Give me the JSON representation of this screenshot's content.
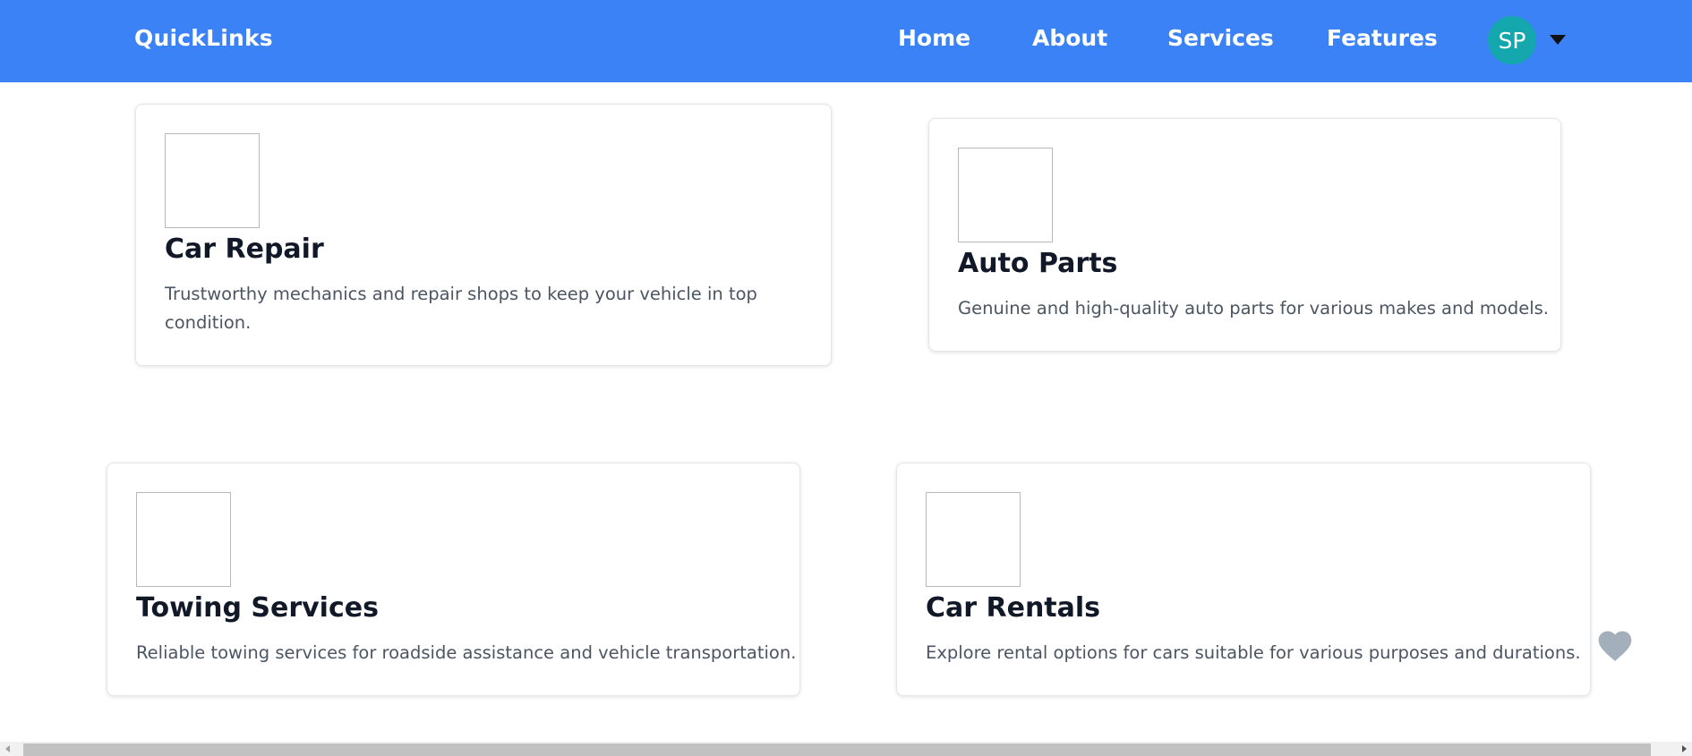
{
  "navbar": {
    "brand": "QuickLinks",
    "links": [
      {
        "label": "Home"
      },
      {
        "label": "About"
      },
      {
        "label": "Services"
      },
      {
        "label": "Features"
      }
    ],
    "avatar_initials": "SP",
    "colors": {
      "background": "#3b82f6",
      "avatar": "#14a8ae"
    }
  },
  "cards": [
    {
      "title": "Car Repair",
      "description": "Trustworthy mechanics and repair shops to keep your vehicle in top condition."
    },
    {
      "title": "Auto Parts",
      "description": "Genuine and high-quality auto parts for various makes and models."
    },
    {
      "title": "Towing Services",
      "description": "Reliable towing services for roadside assistance and vehicle transportation."
    },
    {
      "title": "Car Rentals",
      "description": "Explore rental options for cars suitable for various purposes and durations."
    }
  ],
  "icons": {
    "favorite": "heart-icon",
    "dropdown": "caret-down-icon"
  }
}
